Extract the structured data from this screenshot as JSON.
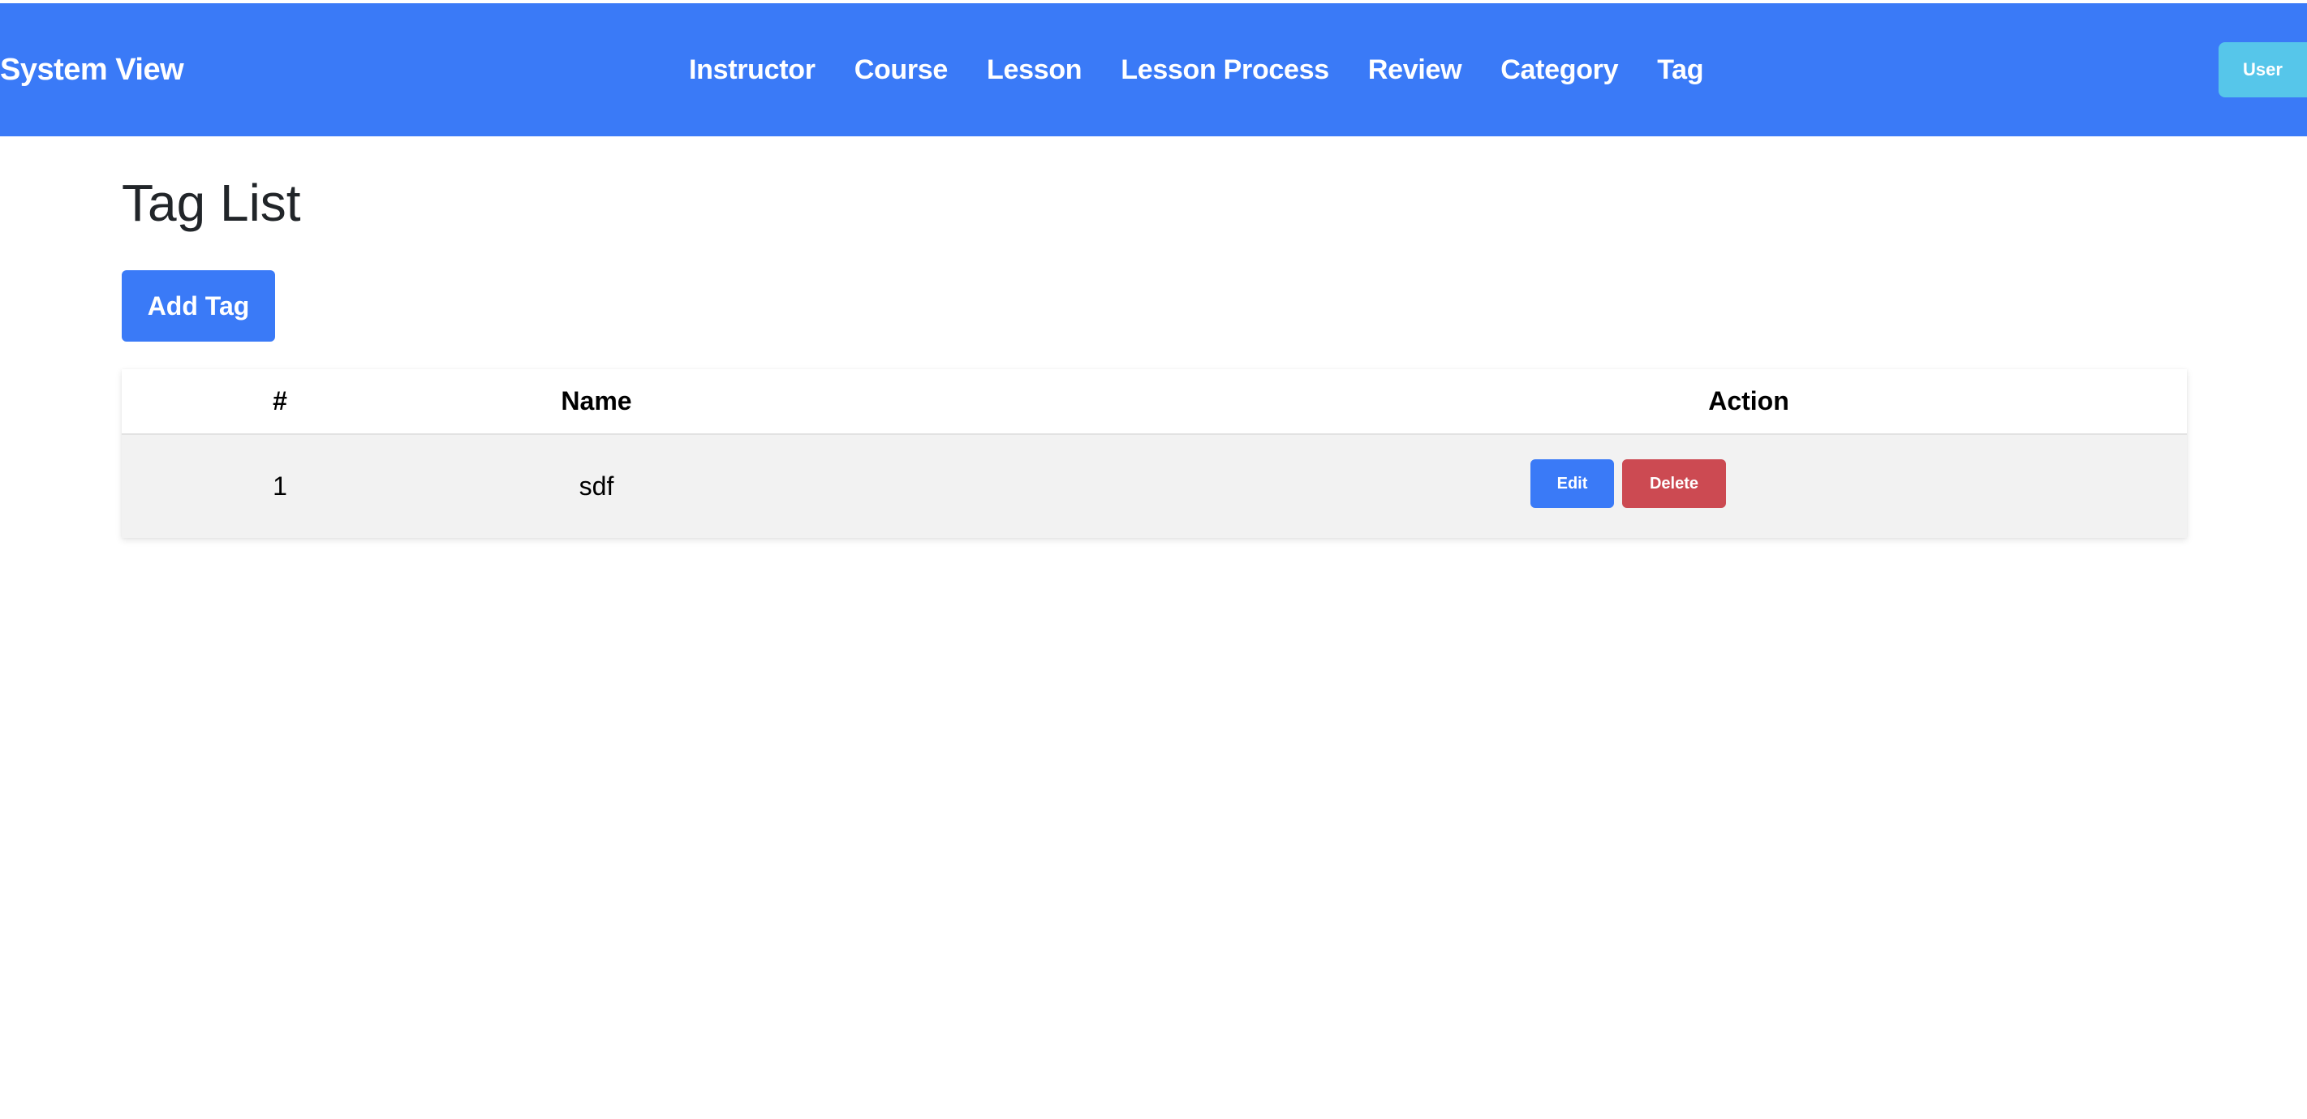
{
  "navbar": {
    "brand": "System View",
    "links": [
      "Instructor",
      "Course",
      "Lesson",
      "Lesson Process",
      "Review",
      "Category",
      "Tag"
    ],
    "user_label": "User",
    "background_color": "#3a7af7"
  },
  "main": {
    "title": "Tag List",
    "add_button_label": "Add Tag",
    "table": {
      "headers": [
        "#",
        "Name",
        "Action"
      ],
      "rows": [
        {
          "number": "1",
          "name": "sdf",
          "edit_label": "Edit",
          "delete_label": "Delete"
        }
      ]
    }
  },
  "colors": {
    "primary": "#3a7af7",
    "danger": "#cc4a52",
    "info": "#56c6ea",
    "row_background": "#f2f2f2"
  }
}
